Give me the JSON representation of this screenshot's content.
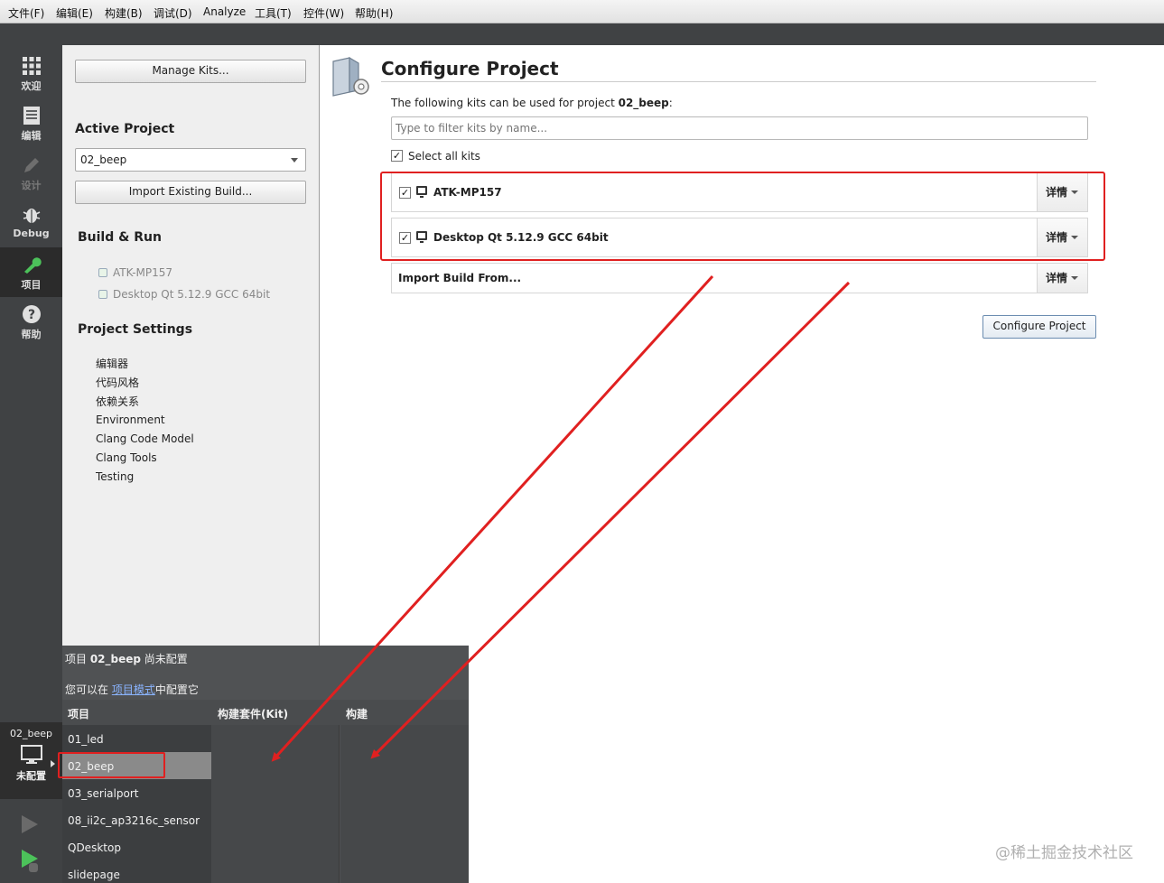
{
  "menubar": {
    "items": [
      "文件(F)",
      "编辑(E)",
      "构建(B)",
      "调试(D)",
      "Analyze",
      "工具(T)",
      "控件(W)",
      "帮助(H)"
    ]
  },
  "modes": [
    {
      "label": "欢迎",
      "icon": "grid-icon"
    },
    {
      "label": "编辑",
      "icon": "document-icon"
    },
    {
      "label": "设计",
      "icon": "pencil-icon"
    },
    {
      "label": "Debug",
      "icon": "bug-icon"
    },
    {
      "label": "项目",
      "icon": "wrench-icon"
    },
    {
      "label": "帮助",
      "icon": "help-icon"
    }
  ],
  "project_pane": {
    "manage_kits": "Manage Kits...",
    "active_project_heading": "Active Project",
    "active_project_value": "02_beep",
    "import_build": "Import Existing Build...",
    "build_run_heading": "Build & Run",
    "kits": [
      "ATK-MP157",
      "Desktop Qt 5.12.9 GCC 64bit"
    ],
    "settings_heading": "Project Settings",
    "settings": [
      "编辑器",
      "代码风格",
      "依赖关系",
      "Environment",
      "Clang Code Model",
      "Clang Tools",
      "Testing"
    ]
  },
  "configure": {
    "title": "Configure Project",
    "desc_prefix": "The following kits can be used for project ",
    "desc_project": "02_beep",
    "desc_suffix": ":",
    "filter_placeholder": "Type to filter kits by name...",
    "select_all": "Select all kits",
    "kit_rows": [
      {
        "name": "ATK-MP157",
        "checked": "✓",
        "details": "详情"
      },
      {
        "name": "Desktop Qt 5.12.9 GCC 64bit",
        "checked": "✓",
        "details": "详情"
      }
    ],
    "import_row": {
      "name": "Import Build From...",
      "details": "详情"
    },
    "configure_button": "Configure Project"
  },
  "popup": {
    "line1_prefix": "项目 ",
    "line1_project": "02_beep",
    "line1_suffix": " 尚未配置",
    "line2_prefix": "您可以在 ",
    "line2_link": "项目模式",
    "line2_suffix": "中配置它",
    "col_project": "项目",
    "col_kit": "构建套件(Kit)",
    "col_build": "构建",
    "projects": [
      "01_led",
      "02_beep",
      "03_serialport",
      "08_ii2c_ap3216c_sensor",
      "QDesktop",
      "slidepage"
    ]
  },
  "status": {
    "project_name": "02_beep",
    "state": "未配置"
  },
  "watermark": "@稀土掘金技术社区",
  "colors": {
    "accent_red": "#e02020",
    "modebar": "#404244",
    "link": "#8ab4ff"
  }
}
